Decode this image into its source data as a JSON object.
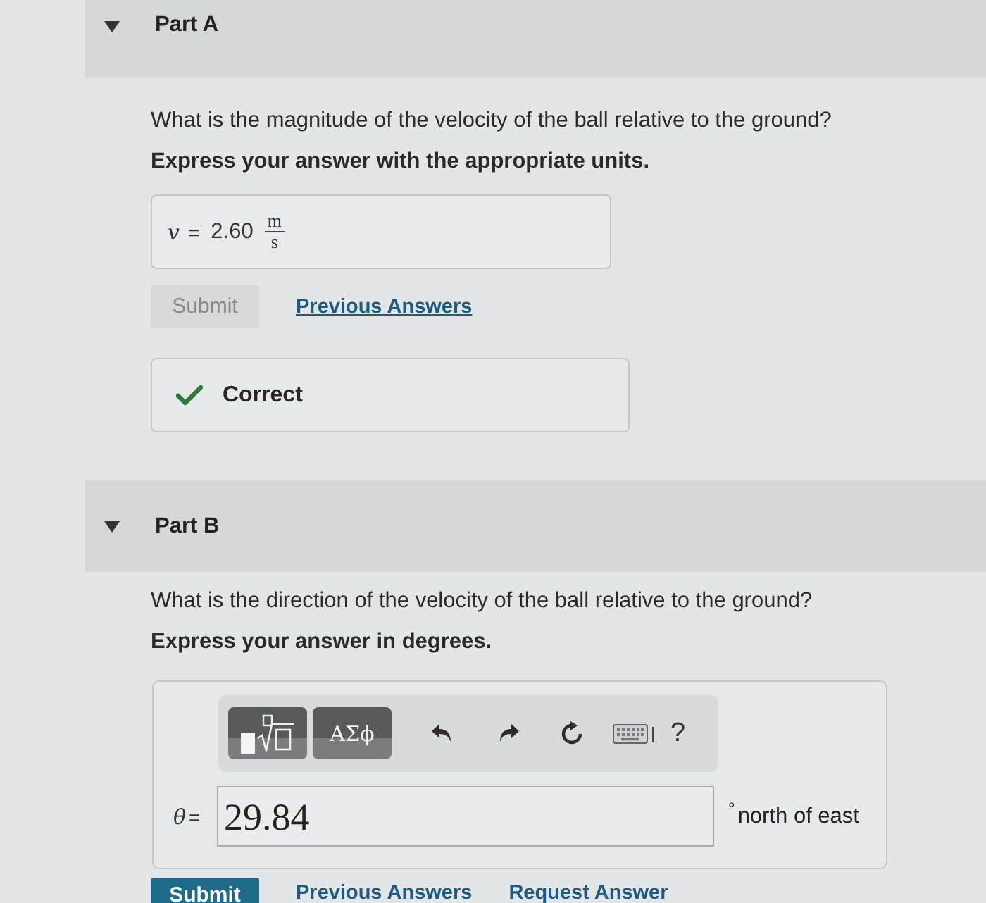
{
  "parts": [
    {
      "title": "Part A",
      "expanded": true,
      "question": "What is the magnitude of the velocity of the ball relative to the ground?",
      "instruction": "Express your answer with the appropriate units.",
      "answer": {
        "kind": "units",
        "symbol": "v",
        "relation": "=",
        "value": "2.60",
        "unit_numerator": "m",
        "unit_denominator": "s"
      },
      "actions": [
        {
          "kind": "button",
          "label": "Submit",
          "disabled": true
        },
        {
          "kind": "link",
          "label": "Previous Answers"
        }
      ],
      "feedback": {
        "kind": "correct",
        "text": "Correct"
      }
    },
    {
      "title": "Part B",
      "expanded": true,
      "question": "What is the direction of the velocity of the ball relative to the ground?",
      "instruction": "Express your answer in degrees.",
      "answer": {
        "kind": "editor",
        "toolbar": [
          {
            "kind": "templates"
          },
          {
            "kind": "greek",
            "label": "ΑΣϕ"
          },
          {
            "kind": "undo"
          },
          {
            "kind": "redo"
          },
          {
            "kind": "reset"
          },
          {
            "kind": "keyboard"
          },
          {
            "kind": "help",
            "label": "?"
          }
        ],
        "symbol": "θ",
        "relation": "=",
        "value": "29.84",
        "unit": "°",
        "suffix": "north of east"
      },
      "actions": [
        {
          "kind": "button",
          "label": "Submit",
          "disabled": false
        },
        {
          "kind": "link",
          "label": "Previous Answers"
        },
        {
          "kind": "link",
          "label": "Request Answer"
        }
      ]
    }
  ]
}
